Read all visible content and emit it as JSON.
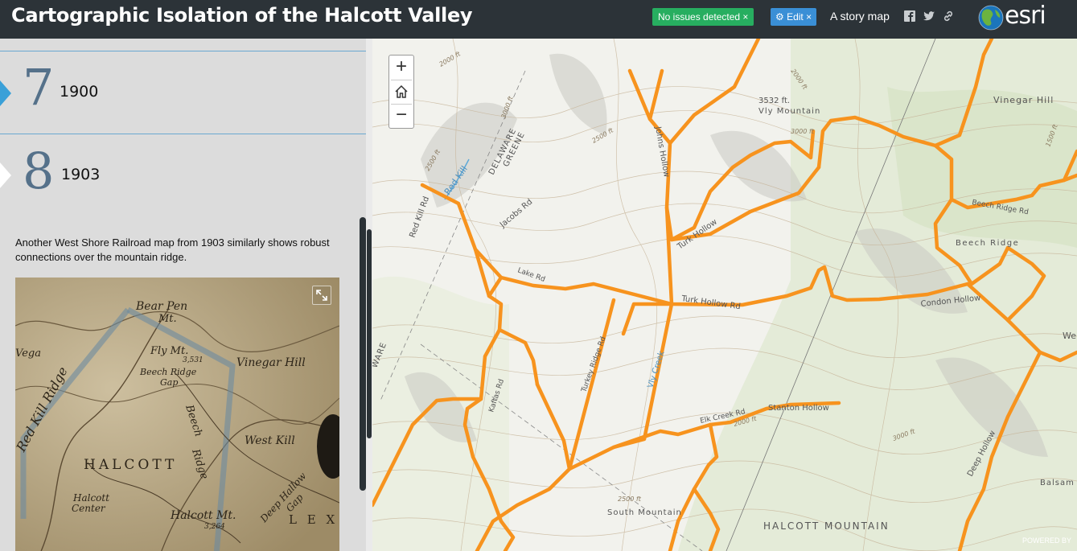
{
  "header": {
    "title": "Cartographic Isolation of the Halcott Valley",
    "issues_badge": "No issues detected ×",
    "edit_badge": "⚙ Edit ×",
    "story_label": "A story map",
    "logo_text": "esri"
  },
  "sidebar": {
    "entries": [
      {
        "number": "7",
        "year": "1900"
      },
      {
        "number": "8",
        "year": "1903"
      }
    ],
    "description": "Another West Shore Railroad map from 1903 similarly shows robust connections over the mountain ridge."
  },
  "historic_map": {
    "labels": [
      "Bear Pen",
      "Mt.",
      "Fly Mt.",
      "3,531",
      "Beech Ridge",
      "Gap",
      "Vinegar Hill",
      "Vega",
      "Red Kill Ridge",
      "Beech",
      "Ridge",
      "West Kill",
      "HALCOTT",
      "Halcott",
      "Center",
      "Halcott Mt.",
      "3,264",
      "Deep Hallow",
      "Gap",
      "L E X"
    ]
  },
  "map": {
    "zoom_in": "+",
    "zoom_out": "−",
    "labels": {
      "delaware": "DELAWARE",
      "greene": "GREENE",
      "red_kill": "Red Kill",
      "red_kill_rd": "Red Kill Rd",
      "jacobs_rd": "Jacobs Rd",
      "johns_hollow": "Johns Hollow",
      "vly_mountain": "Vly Mountain",
      "elev_3532": "3532 ft.",
      "vinegar_hill": "Vinegar Hill",
      "beech_ridge": "Beech Ridge",
      "beech_ridge_rd": "Beech Ridge Rd",
      "turk_hollow_rd": "Turk Hollow Rd",
      "condon_hollow": "Condon Hollow",
      "turk_hollow": "Turk Hollow",
      "south_mountain": "South Mountain",
      "halcott_mountain": "HALCOTT MOUNTAIN",
      "deep_hollow": "Deep Hollow",
      "balsam_mountain": "Balsam Mountain",
      "stanton_hollow": "Stanton Hollow",
      "elk_creek_rd": "Elk Creek Rd",
      "kaftas_rd": "Kaftas Rd",
      "turkey_ridge_rd": "Turkey Ridge Rd",
      "vly_creek": "Vly Creek",
      "lake_rd": "Lake Rd",
      "elev_2000a": "2000 ft",
      "elev_3000a": "3000 ft",
      "elev_2500a": "2500 ft",
      "elev_2500b": "2500 ft",
      "elev_2000b": "2000 ft",
      "elev_3000b": "3000 ft",
      "elev_3000c": "3000 ft",
      "elev_2500c": "2500 ft",
      "elev_2000c": "2000 ft",
      "elev_1500": "1500 ft",
      "ware": "WARE",
      "we": "We"
    },
    "powered_by": "POWERED BY",
    "road_color": "#f7931e"
  }
}
